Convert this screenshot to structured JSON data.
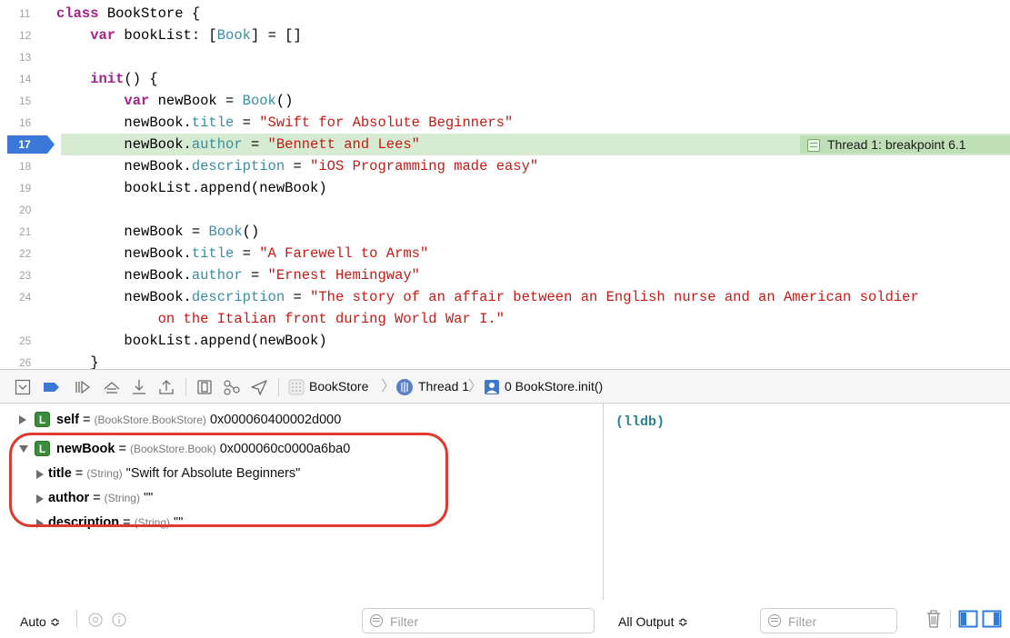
{
  "editor": {
    "lines": [
      {
        "num": "11",
        "tokens": [
          {
            "t": "class ",
            "c": "kw"
          },
          {
            "t": "BookStore {",
            "c": "plain"
          }
        ]
      },
      {
        "num": "12",
        "tokens": [
          {
            "t": "    var ",
            "c": "kw"
          },
          {
            "t": "bookList: [",
            "c": "plain"
          },
          {
            "t": "Book",
            "c": "ty"
          },
          {
            "t": "] = []",
            "c": "plain"
          }
        ]
      },
      {
        "num": "13",
        "tokens": []
      },
      {
        "num": "14",
        "tokens": [
          {
            "t": "    init",
            "c": "kw"
          },
          {
            "t": "() {",
            "c": "plain"
          }
        ]
      },
      {
        "num": "15",
        "tokens": [
          {
            "t": "        var ",
            "c": "kw"
          },
          {
            "t": "newBook = ",
            "c": "plain"
          },
          {
            "t": "Book",
            "c": "ty"
          },
          {
            "t": "()",
            "c": "plain"
          }
        ]
      },
      {
        "num": "16",
        "tokens": [
          {
            "t": "        newBook.",
            "c": "plain"
          },
          {
            "t": "title",
            "c": "prop"
          },
          {
            "t": " = ",
            "c": "plain"
          },
          {
            "t": "\"Swift for Absolute Beginners\"",
            "c": "str"
          }
        ]
      },
      {
        "num": "17",
        "current": true,
        "tokens": [
          {
            "t": "        newBook.",
            "c": "plain"
          },
          {
            "t": "author",
            "c": "prop"
          },
          {
            "t": " = ",
            "c": "plain"
          },
          {
            "t": "\"Bennett and Lees\"",
            "c": "str"
          }
        ]
      },
      {
        "num": "18",
        "tokens": [
          {
            "t": "        newBook.",
            "c": "plain"
          },
          {
            "t": "description",
            "c": "prop"
          },
          {
            "t": " = ",
            "c": "plain"
          },
          {
            "t": "\"iOS Programming made easy\"",
            "c": "str"
          }
        ]
      },
      {
        "num": "19",
        "tokens": [
          {
            "t": "        bookList.append(newBook)",
            "c": "plain"
          }
        ]
      },
      {
        "num": "20",
        "tokens": []
      },
      {
        "num": "21",
        "tokens": [
          {
            "t": "        newBook = ",
            "c": "plain"
          },
          {
            "t": "Book",
            "c": "ty"
          },
          {
            "t": "()",
            "c": "plain"
          }
        ]
      },
      {
        "num": "22",
        "tokens": [
          {
            "t": "        newBook.",
            "c": "plain"
          },
          {
            "t": "title",
            "c": "prop"
          },
          {
            "t": " = ",
            "c": "plain"
          },
          {
            "t": "\"A Farewell to Arms\"",
            "c": "str"
          }
        ]
      },
      {
        "num": "23",
        "tokens": [
          {
            "t": "        newBook.",
            "c": "plain"
          },
          {
            "t": "author",
            "c": "prop"
          },
          {
            "t": " = ",
            "c": "plain"
          },
          {
            "t": "\"Ernest Hemingway\"",
            "c": "str"
          }
        ]
      },
      {
        "num": "24",
        "tokens": [
          {
            "t": "        newBook.",
            "c": "plain"
          },
          {
            "t": "description",
            "c": "prop"
          },
          {
            "t": " = ",
            "c": "plain"
          },
          {
            "t": "\"The story of an affair between an English nurse and an American soldier",
            "c": "str"
          }
        ]
      },
      {
        "num": "",
        "tokens": [
          {
            "t": "            on the Italian front during World War I.\"",
            "c": "str"
          }
        ]
      },
      {
        "num": "25",
        "tokens": [
          {
            "t": "        bookList.append(newBook)",
            "c": "plain"
          }
        ]
      },
      {
        "num": "26",
        "tokens": [
          {
            "t": "    }",
            "c": "plain"
          }
        ]
      }
    ],
    "breakpoint_label": "Thread 1: breakpoint 6.1"
  },
  "debug_bar": {
    "crumb_target": "BookStore",
    "crumb_thread": "Thread 1",
    "crumb_frame": "0 BookStore.init()",
    "icons": [
      "hide-debug-area-icon",
      "breakpoints-toggle-icon",
      "continue-icon",
      "step-over-icon",
      "step-into-icon",
      "step-out-icon",
      "view-hierarchy-icon",
      "memory-graph-icon",
      "simulate-location-icon"
    ]
  },
  "variables": {
    "self": {
      "name": "self",
      "eq": " = ",
      "type": "(BookStore.BookStore)",
      "value": " 0x000060400002d000"
    },
    "newBook": {
      "name": "newBook",
      "eq": " = ",
      "type": "(BookStore.Book)",
      "value": " 0x000060c0000a6ba0"
    },
    "title": {
      "name": "title",
      "eq": " = ",
      "type": "(String)",
      "value": " \"Swift for Absolute Beginners\""
    },
    "author": {
      "name": "author",
      "eq": " = ",
      "type": "(String)",
      "value": " \"\""
    },
    "description": {
      "name": "description",
      "eq": " = ",
      "type": "(String)",
      "value": " \"\""
    },
    "badge_letter": "L"
  },
  "console": {
    "prompt": "(lldb)"
  },
  "bottom_bar": {
    "scope": "Auto ≎",
    "vars_filter_placeholder": "Filter",
    "output": "All Output ≎",
    "console_filter_placeholder": "Filter"
  },
  "colors": {
    "keyword": "#a4228a",
    "type": "#3a8ea0",
    "string": "#c41a16",
    "current_line": "#d6ebd2",
    "breakpoint": "#3a79d8",
    "annotation_ring": "#e03a2f"
  }
}
